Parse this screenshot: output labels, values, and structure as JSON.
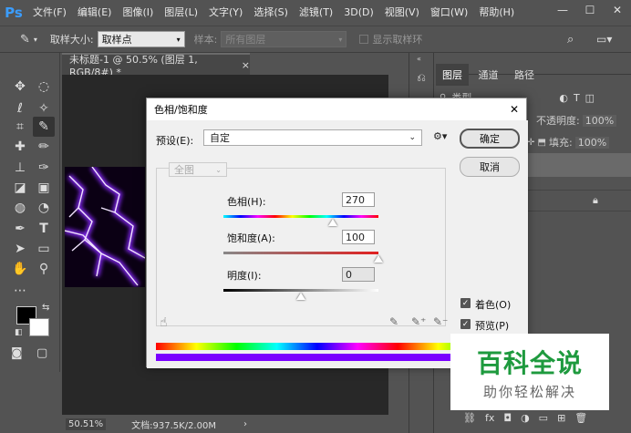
{
  "app": {
    "logo": "Ps"
  },
  "menu": [
    "文件(F)",
    "编辑(E)",
    "图像(I)",
    "图层(L)",
    "文字(Y)",
    "选择(S)",
    "滤镜(T)",
    "3D(D)",
    "视图(V)",
    "窗口(W)",
    "帮助(H)"
  ],
  "window_controls": {
    "minimize": "—",
    "maximize": "☐",
    "close": "✕"
  },
  "options_bar": {
    "sample_size_label": "取样大小:",
    "sample_size_value": "取样点",
    "sample_label": "样本:",
    "sample_value": "所有图层",
    "show_ring_label": "显示取样环"
  },
  "document": {
    "tab_title": "未标题-1 @ 50.5% (图层 1, RGB/8#) *",
    "tab_close": "×",
    "zoom": "50.51%",
    "doc_info": "文档:937.5K/2.00M"
  },
  "layers_panel": {
    "tabs": [
      "图层",
      "通道",
      "路径"
    ],
    "kind_label": "类型",
    "opacity_label": "不透明度:",
    "opacity_value": "100%",
    "fill_label": "填充:",
    "fill_value": "100%"
  },
  "dialog": {
    "title": "色相/饱和度",
    "close": "✕",
    "preset_label": "预设(E):",
    "preset_value": "自定",
    "ok": "确定",
    "cancel": "取消",
    "channel_value": "全图",
    "hue_label": "色相(H):",
    "hue_value": "270",
    "saturation_label": "饱和度(A):",
    "saturation_value": "100",
    "lightness_label": "明度(I):",
    "lightness_value": "0",
    "colorize_label": "着色(O)",
    "preview_label": "预览(P)",
    "hue_position": 0.708,
    "saturation_position": 1.0,
    "lightness_position": 0.5
  },
  "watermark": {
    "main": "百科全说",
    "sub": "助你轻松解决"
  },
  "colors": {
    "accent_purple": "#7a00ff",
    "watermark_green": "#1e9a3e"
  }
}
